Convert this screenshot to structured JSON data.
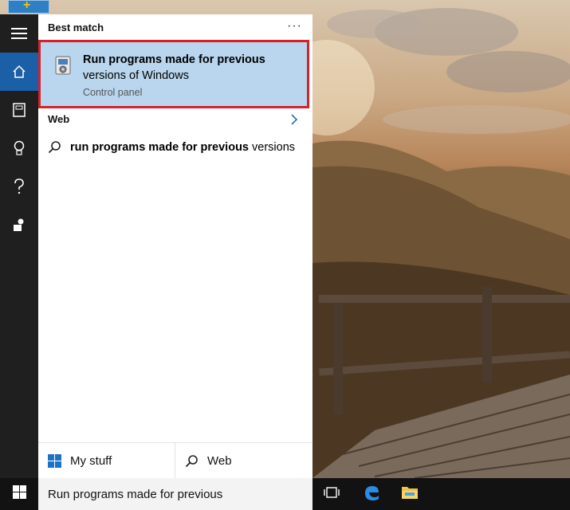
{
  "search_panel": {
    "best_match_heading": "Best match",
    "more_options_glyph": "···",
    "best_match": {
      "title": "Run programs made for previous",
      "subtitle": "versions of Windows",
      "type": "Control panel",
      "icon": "compatibility-troubleshooter-icon"
    },
    "web_heading": "Web",
    "web_suggestion": {
      "bold_part": "run programs made for previous",
      "rest": " versions",
      "icon": "search-icon"
    },
    "scope": {
      "my_stuff_label": "My stuff",
      "web_label": "Web"
    }
  },
  "rail": {
    "items": [
      "hamburger-menu-icon",
      "home-icon",
      "notebook-icon",
      "lightbulb-icon",
      "help-icon",
      "feedback-icon"
    ]
  },
  "taskbar": {
    "search_value": "Run programs made for previous",
    "items": [
      "start-icon",
      "task-view-icon",
      "edge-icon",
      "file-explorer-icon"
    ]
  },
  "colors": {
    "accent": "#1b5fa6",
    "selection": "#b9d6ee",
    "highlight_border": "#d6212b"
  }
}
